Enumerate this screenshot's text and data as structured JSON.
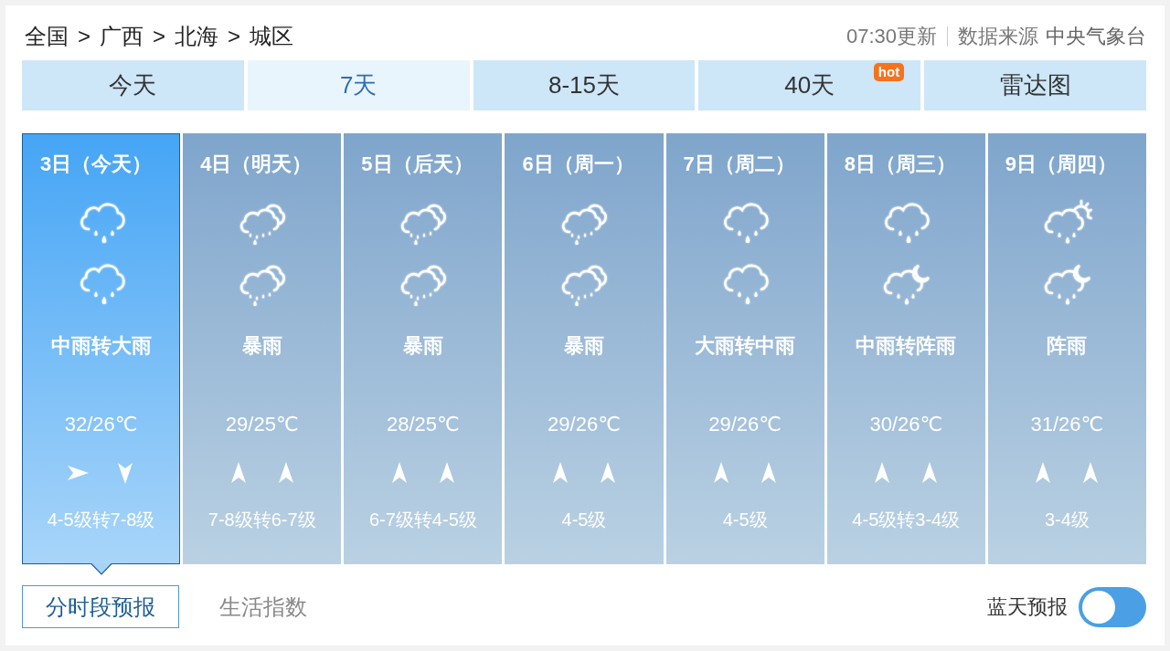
{
  "breadcrumb": {
    "items": [
      "全国",
      "广西",
      "北海",
      "城区"
    ],
    "separator": ">"
  },
  "update": {
    "time_text": "07:30更新",
    "source_label": "数据来源",
    "source": "中央气象台"
  },
  "tabs": [
    {
      "label": "今天",
      "selected": false
    },
    {
      "label": "7天",
      "selected": true
    },
    {
      "label": "8-15天",
      "selected": false
    },
    {
      "label": "40天",
      "selected": false,
      "badge": "hot"
    },
    {
      "label": "雷达图",
      "selected": false
    }
  ],
  "days": [
    {
      "date": "3日（今天）",
      "selected": true,
      "icons": [
        {
          "kind": "rain"
        },
        {
          "kind": "rain"
        }
      ],
      "weather": "中雨转大雨",
      "temperature": "32/26℃",
      "winds": [
        {
          "kind": "right"
        },
        {
          "kind": "down"
        }
      ],
      "wind_level": "4-5级转7-8级"
    },
    {
      "date": "4日（明天）",
      "selected": false,
      "icons": [
        {
          "kind": "storm"
        },
        {
          "kind": "storm"
        }
      ],
      "weather": "暴雨",
      "temperature": "29/25℃",
      "winds": [
        {
          "kind": "up"
        },
        {
          "kind": "up"
        }
      ],
      "wind_level": "7-8级转6-7级"
    },
    {
      "date": "5日（后天）",
      "selected": false,
      "icons": [
        {
          "kind": "storm"
        },
        {
          "kind": "storm"
        }
      ],
      "weather": "暴雨",
      "temperature": "28/25℃",
      "winds": [
        {
          "kind": "up"
        },
        {
          "kind": "up"
        }
      ],
      "wind_level": "6-7级转4-5级"
    },
    {
      "date": "6日（周一）",
      "selected": false,
      "icons": [
        {
          "kind": "storm"
        },
        {
          "kind": "storm"
        }
      ],
      "weather": "暴雨",
      "temperature": "29/26℃",
      "winds": [
        {
          "kind": "up"
        },
        {
          "kind": "up"
        }
      ],
      "wind_level": "4-5级"
    },
    {
      "date": "7日（周二）",
      "selected": false,
      "icons": [
        {
          "kind": "rain"
        },
        {
          "kind": "rain"
        }
      ],
      "weather": "大雨转中雨",
      "temperature": "29/26℃",
      "winds": [
        {
          "kind": "up"
        },
        {
          "kind": "up"
        }
      ],
      "wind_level": "4-5级"
    },
    {
      "date": "8日（周三）",
      "selected": false,
      "icons": [
        {
          "kind": "rain"
        },
        {
          "kind": "rain-night"
        }
      ],
      "weather": "中雨转阵雨",
      "temperature": "30/26℃",
      "winds": [
        {
          "kind": "up"
        },
        {
          "kind": "up"
        }
      ],
      "wind_level": "4-5级转3-4级"
    },
    {
      "date": "9日（周四）",
      "selected": false,
      "icons": [
        {
          "kind": "rain-day"
        },
        {
          "kind": "rain-night"
        }
      ],
      "weather": "阵雨",
      "temperature": "31/26℃",
      "winds": [
        {
          "kind": "up"
        },
        {
          "kind": "up"
        }
      ],
      "wind_level": "3-4级"
    }
  ],
  "sub_tabs": [
    {
      "label": "分时段预报",
      "selected": true
    },
    {
      "label": "生活指数",
      "selected": false
    }
  ],
  "sky_forecast": {
    "label": "蓝天预报",
    "on": true
  }
}
